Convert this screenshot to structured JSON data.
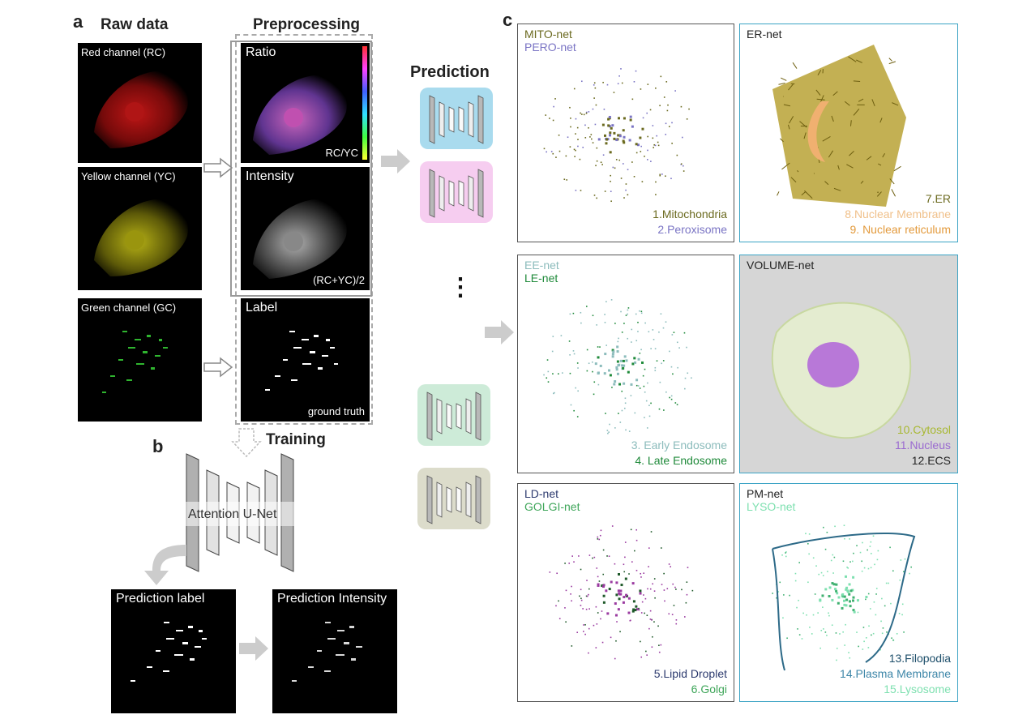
{
  "panel_a": {
    "letter": "a",
    "raw_heading": "Raw data",
    "pre_heading": "Preprocessing",
    "raw_tiles": [
      "Red channel (RC)",
      "Yellow channel (YC)",
      "Green channel (GC)"
    ],
    "pre_tiles": [
      {
        "label": "Ratio",
        "corner": "RC/YC"
      },
      {
        "label": "Intensity",
        "corner": "(RC+YC)/2"
      },
      {
        "label": "Label",
        "corner": "ground truth"
      }
    ]
  },
  "panel_b": {
    "letter": "b",
    "training_heading": "Training",
    "network_label": "Attention U-Net",
    "outputs": [
      "Prediction label",
      "Prediction Intensity"
    ]
  },
  "panel_c": {
    "letter": "c",
    "prediction_heading": "Prediction",
    "continuation": "⋮",
    "unet_colors": [
      "#a9dbee",
      "#f6cdf0",
      "#cdebd8",
      "#dcdccb"
    ],
    "nets": [
      {
        "names": [
          {
            "text": "MITO-net",
            "color": "#6b6a1f"
          },
          {
            "text": "PERO-net",
            "color": "#7a74c4"
          }
        ],
        "organelles": [
          {
            "text": "1.Mitochondria",
            "color": "#6b6a1f"
          },
          {
            "text": "2.Peroxisome",
            "color": "#7a74c4"
          }
        ]
      },
      {
        "names": [
          {
            "text": "ER-net",
            "color": "#222222"
          }
        ],
        "organelles": [
          {
            "text": "7.ER",
            "color": "#6b6a1f"
          },
          {
            "text": "8.Nuclear Membrane",
            "color": "#f0c08a"
          },
          {
            "text": "9. Nuclear reticulum",
            "color": "#e39a3c"
          }
        ]
      },
      {
        "names": [
          {
            "text": "EE-net",
            "color": "#8cbcbc"
          },
          {
            "text": "LE-net",
            "color": "#1f8a3a"
          }
        ],
        "organelles": [
          {
            "text": "3. Early Endosome",
            "color": "#8cbcbc"
          },
          {
            "text": "4. Late Endosome",
            "color": "#1f8a3a"
          }
        ]
      },
      {
        "names": [
          {
            "text": "VOLUME-net",
            "color": "#222222"
          }
        ],
        "organelles": [
          {
            "text": "10.Cytosol",
            "color": "#a8b832"
          },
          {
            "text": "11.Nucleus",
            "color": "#9a6ad0"
          },
          {
            "text": "12.ECS",
            "color": "#222222"
          }
        ]
      },
      {
        "names": [
          {
            "text": "LD-net",
            "color": "#2c3a6e"
          },
          {
            "text": "GOLGI-net",
            "color": "#3fa65a"
          }
        ],
        "organelles": [
          {
            "text": "5.Lipid Droplet",
            "color": "#2c3a6e"
          },
          {
            "text": "6.Golgi",
            "color": "#3fa65a"
          }
        ]
      },
      {
        "names": [
          {
            "text": "PM-net",
            "color": "#222222"
          },
          {
            "text": "LYSO-net",
            "color": "#7ee0b0"
          }
        ],
        "organelles": [
          {
            "text": "13.Filopodia",
            "color": "#1d4e6a"
          },
          {
            "text": "14.Plasma Membrane",
            "color": "#3d86a8"
          },
          {
            "text": "15.Lysosome",
            "color": "#7ee0b0"
          }
        ]
      }
    ]
  }
}
